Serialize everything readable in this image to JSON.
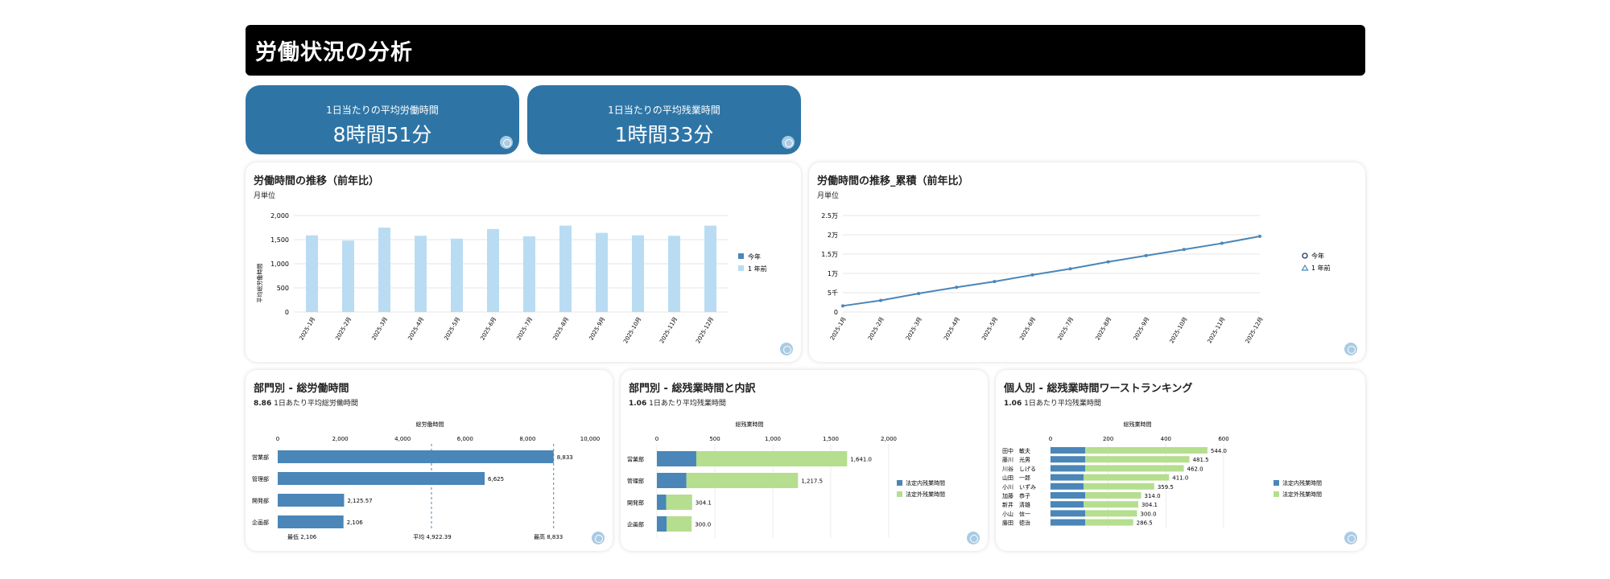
{
  "header": {
    "title": "労働状況の分析"
  },
  "kpis": [
    {
      "label": "1日当たりの平均労働時間",
      "value": "8時間51分"
    },
    {
      "label": "1日当たりの平均残業時間",
      "value": "1時間33分"
    }
  ],
  "colors": {
    "header_bg": "#000000",
    "kpi_bg": "#2e75a6",
    "light_blue": "#b9dcf3",
    "steel_blue": "#4a86b8",
    "green": "#b5de8e"
  },
  "months": [
    "2025-1月",
    "2025-2月",
    "2025-3月",
    "2025-4月",
    "2025-5月",
    "2025-6月",
    "2025-7月",
    "2025-8月",
    "2025-9月",
    "2025-10月",
    "2025-11月",
    "2025-12月"
  ],
  "card1": {
    "title": "労働時間の推移（前年比）",
    "subtitle": "月単位",
    "legend": [
      "今年",
      "1 年前"
    ],
    "chart_data": {
      "type": "bar",
      "categories": [
        "2025-1月",
        "2025-2月",
        "2025-3月",
        "2025-4月",
        "2025-5月",
        "2025-6月",
        "2025-7月",
        "2025-8月",
        "2025-9月",
        "2025-10月",
        "2025-11月",
        "2025-12月"
      ],
      "series": [
        {
          "name": "今年",
          "values": [
            1590,
            1480,
            1750,
            1580,
            1520,
            1720,
            1570,
            1790,
            1640,
            1590,
            1580,
            1790
          ]
        }
      ],
      "ylabel": "平均総労働時間",
      "ylim": [
        0,
        2000
      ],
      "yticks": [
        "0",
        "500",
        "1,000",
        "1,500",
        "2,000"
      ]
    }
  },
  "card2": {
    "title": "労働時間の推移_累積（前年比）",
    "subtitle": "月単位",
    "legend": [
      "今年",
      "1 年前"
    ],
    "chart_data": {
      "type": "line",
      "categories": [
        "2025-1月",
        "2025-2月",
        "2025-3月",
        "2025-4月",
        "2025-5月",
        "2025-6月",
        "2025-7月",
        "2025-8月",
        "2025-9月",
        "2025-10月",
        "2025-11月",
        "2025-12月"
      ],
      "series": [
        {
          "name": "今年",
          "values": [
            1600,
            3000,
            4800,
            6400,
            7900,
            9600,
            11200,
            13000,
            14600,
            16200,
            17800,
            19600
          ]
        }
      ],
      "ylim": [
        0,
        25000
      ],
      "yticks": [
        "0",
        "5千",
        "1万",
        "1.5万",
        "2万",
        "2.5万"
      ]
    }
  },
  "card3": {
    "title": "部門別 - 総労働時間",
    "subtitle_value": "8.86",
    "subtitle_text": "1日あたり平均総労働時間",
    "axis_title": "総労働時間",
    "annotations": {
      "min": "最低 2,106",
      "avg": "平均 4,922.39",
      "max": "最高 8,833"
    },
    "chart_data": {
      "type": "bar",
      "orientation": "horizontal",
      "categories": [
        "営業部",
        "管理部",
        "開発部",
        "企画部"
      ],
      "values": [
        8833,
        6625,
        2125.57,
        2106
      ],
      "value_labels": [
        "8,833",
        "6,625",
        "2,125.57",
        "2,106"
      ],
      "xlim": [
        0,
        10000
      ],
      "xticks": [
        "0",
        "2,000",
        "4,000",
        "6,000",
        "8,000",
        "10,000"
      ]
    }
  },
  "card4": {
    "title": "部門別 - 総残業時間と内訳",
    "subtitle_value": "1.06",
    "subtitle_text": "1日あたり平均残業時間",
    "axis_title": "総残業時間",
    "legend": [
      "法定内残業時間",
      "法定外残業時間"
    ],
    "chart_data": {
      "type": "bar",
      "orientation": "horizontal",
      "stacked": true,
      "categories": [
        "営業部",
        "管理部",
        "開発部",
        "企画部"
      ],
      "series": [
        {
          "name": "法定内残業時間",
          "values": [
            340,
            255,
            80,
            85
          ]
        },
        {
          "name": "法定外残業時間",
          "values": [
            1301,
            962.5,
            224.1,
            215
          ]
        }
      ],
      "totals": [
        "1,641.0",
        "1,217.5",
        "304.1",
        "300.0"
      ],
      "xlim": [
        0,
        2000
      ],
      "xticks": [
        "0",
        "500",
        "1,000",
        "1,500",
        "2,000"
      ]
    }
  },
  "card5": {
    "title": "個人別 - 総残業時間ワーストランキング",
    "subtitle_value": "1.06",
    "subtitle_text": "1日あたり平均残業時間",
    "axis_title": "総残業時間",
    "legend": [
      "法定内残業時間",
      "法定外残業時間"
    ],
    "chart_data": {
      "type": "bar",
      "orientation": "horizontal",
      "stacked": true,
      "categories": [
        "田中　敏夫",
        "藤川　光男",
        "川谷　しげる",
        "山田　一郎",
        "小川　いずみ",
        "加藤　恭子",
        "新井　清雄",
        "小山　信一",
        "藤田　徳治"
      ],
      "series": [
        {
          "name": "法定内残業時間",
          "values": [
            120,
            120,
            120,
            115,
            115,
            120,
            115,
            120,
            120
          ]
        },
        {
          "name": "法定外残業時間",
          "values": [
            424,
            361.5,
            342,
            296,
            244.5,
            194,
            189.1,
            180,
            166.5
          ]
        }
      ],
      "totals": [
        "544.0",
        "481.5",
        "462.0",
        "411.0",
        "359.5",
        "314.0",
        "304.1",
        "300.0",
        "286.5"
      ],
      "xlim": [
        0,
        600
      ],
      "xticks": [
        "0",
        "200",
        "400",
        "600"
      ]
    }
  }
}
